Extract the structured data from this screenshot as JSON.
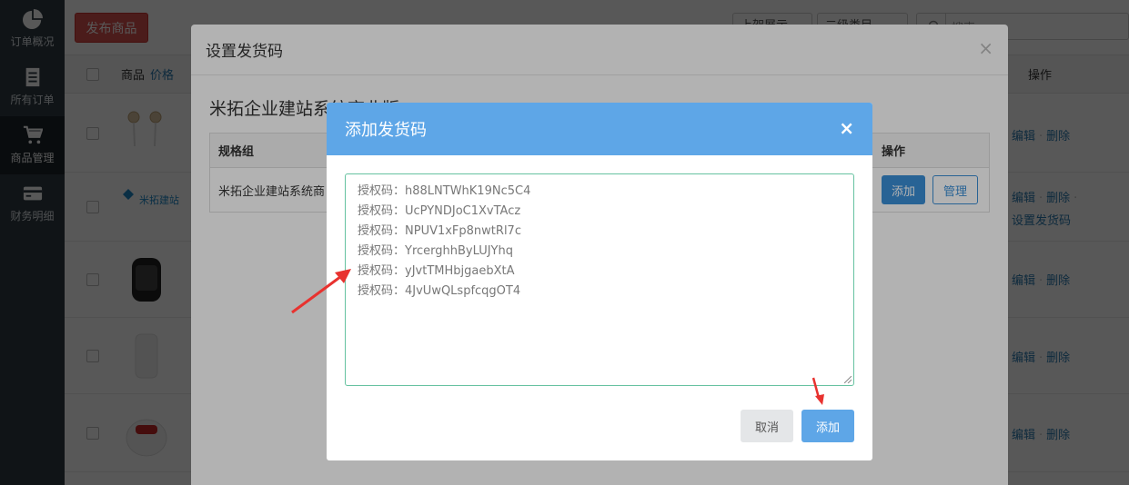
{
  "sidebar": {
    "items": [
      {
        "label": "订单概况",
        "icon": "pie-chart-icon",
        "active": false
      },
      {
        "label": "所有订单",
        "icon": "document-icon",
        "active": false
      },
      {
        "label": "商品管理",
        "icon": "cart-icon",
        "active": true
      },
      {
        "label": "财务明细",
        "icon": "card-icon",
        "active": false
      }
    ]
  },
  "toolbar": {
    "publish_label": "发布商品",
    "select1": "上架展示",
    "select2": "二级类目",
    "search_placeholder": "搜索"
  },
  "table": {
    "col_product": "商品",
    "col_price": "价格",
    "col_ops": "操作",
    "op_edit": "编辑",
    "op_delete": "删除",
    "op_set_code": "设置发货码"
  },
  "modal_outer": {
    "title": "设置发货码",
    "product_title": "米拓企业建站系统商业版",
    "spec_header": "规格组",
    "ops_header": "操作",
    "spec_row_name": "米拓企业建站系统商",
    "btn_add": "添加",
    "btn_manage": "管理"
  },
  "modal_inner": {
    "title": "添加发货码",
    "codes": [
      "授权码：h88LNTWhK19Nc5C4",
      "授权码：UcPYNDJoC1XvTAcz",
      "授权码：NPUV1xFp8nwtRl7c",
      "授权码：YrcerghhByLUJYhq",
      "授权码：yJvtTMHbjgaebXtA",
      "授权码：4JvUwQLspfcqgOT4"
    ],
    "cancel_label": "取消",
    "add_label": "添加"
  },
  "colors": {
    "sidebar": "#2f3a43",
    "modal_header": "#5ea6e7",
    "danger": "#d9534f",
    "annotation_arrow": "#e8322f"
  }
}
